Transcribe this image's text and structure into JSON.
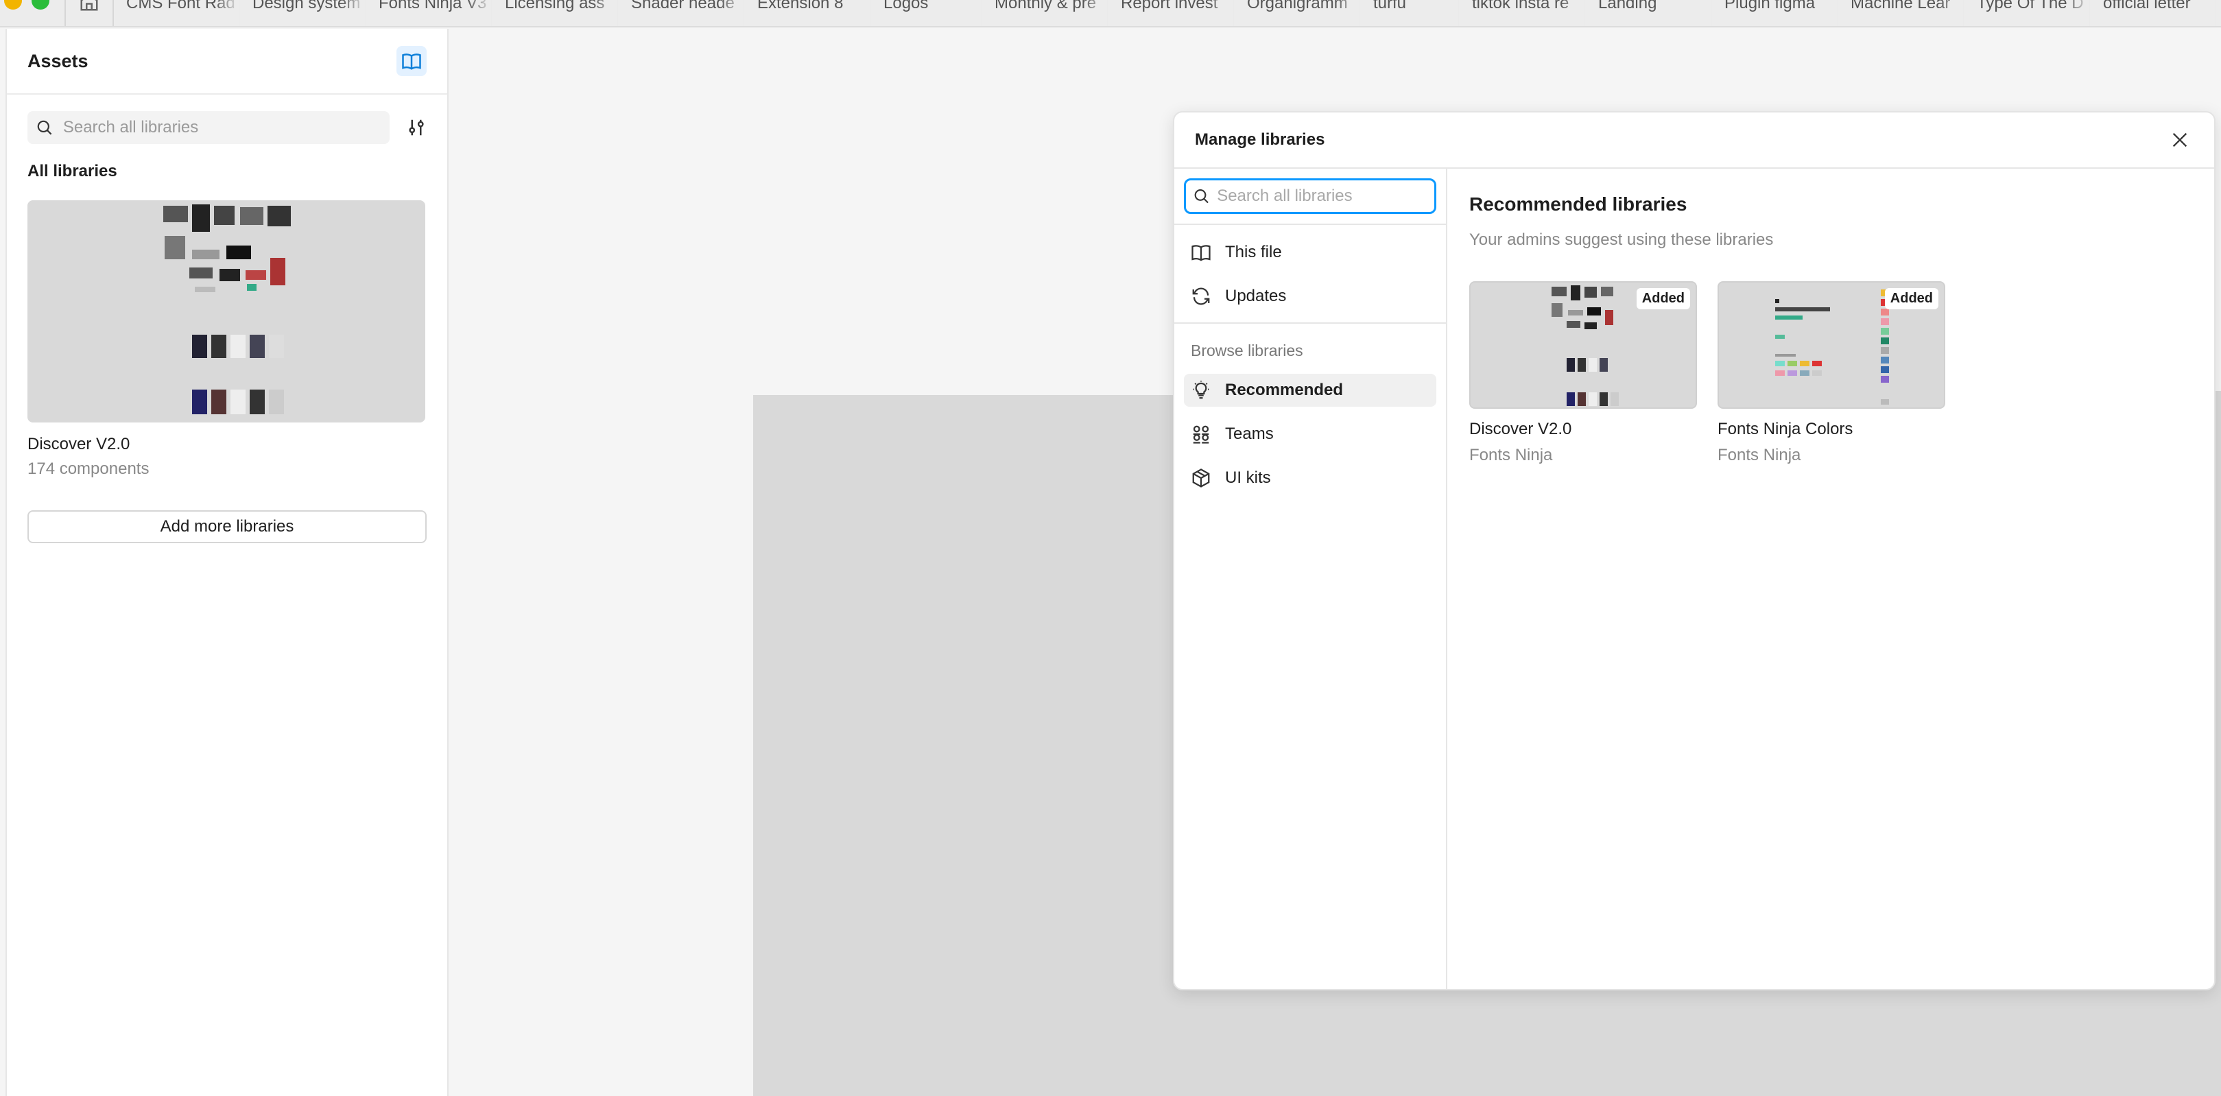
{
  "tabs": [
    "CMS Font Rad",
    "Design system",
    "Fonts Ninja V3",
    "Licensing ass",
    "Shader heade",
    "Extension 8",
    "Logos",
    "Monthly & pre",
    "Report invest",
    "Organigramm",
    "turfu",
    "tiktok insta re",
    "Landing",
    "Plugin figma",
    "Machine Lear",
    "Type Of The D",
    "official letter"
  ],
  "assets": {
    "title": "Assets",
    "search_placeholder": "Search all libraries",
    "section_label": "All libraries",
    "library": {
      "name": "Discover V2.0",
      "count": "174 components"
    },
    "add_more_label": "Add more libraries"
  },
  "modal": {
    "title": "Manage libraries",
    "search_placeholder": "Search all libraries",
    "nav_top": [
      {
        "label": "This file",
        "icon": "book-icon"
      },
      {
        "label": "Updates",
        "icon": "refresh-icon"
      }
    ],
    "browse_label": "Browse libraries",
    "nav_browse": [
      {
        "label": "Recommended",
        "icon": "lightbulb-icon",
        "active": true
      },
      {
        "label": "Teams",
        "icon": "teams-icon",
        "active": false
      },
      {
        "label": "UI kits",
        "icon": "package-icon",
        "active": false
      }
    ],
    "main_title": "Recommended libraries",
    "main_subtitle": "Your admins suggest using these libraries",
    "cards": [
      {
        "name": "Discover V2.0",
        "team": "Fonts Ninja",
        "badge": "Added"
      },
      {
        "name": "Fonts Ninja Colors",
        "team": "Fonts Ninja",
        "badge": "Added"
      }
    ]
  },
  "colors": {
    "accent": "#0d99ff",
    "canvas": "#d9d9d9",
    "panel": "#ffffff"
  }
}
